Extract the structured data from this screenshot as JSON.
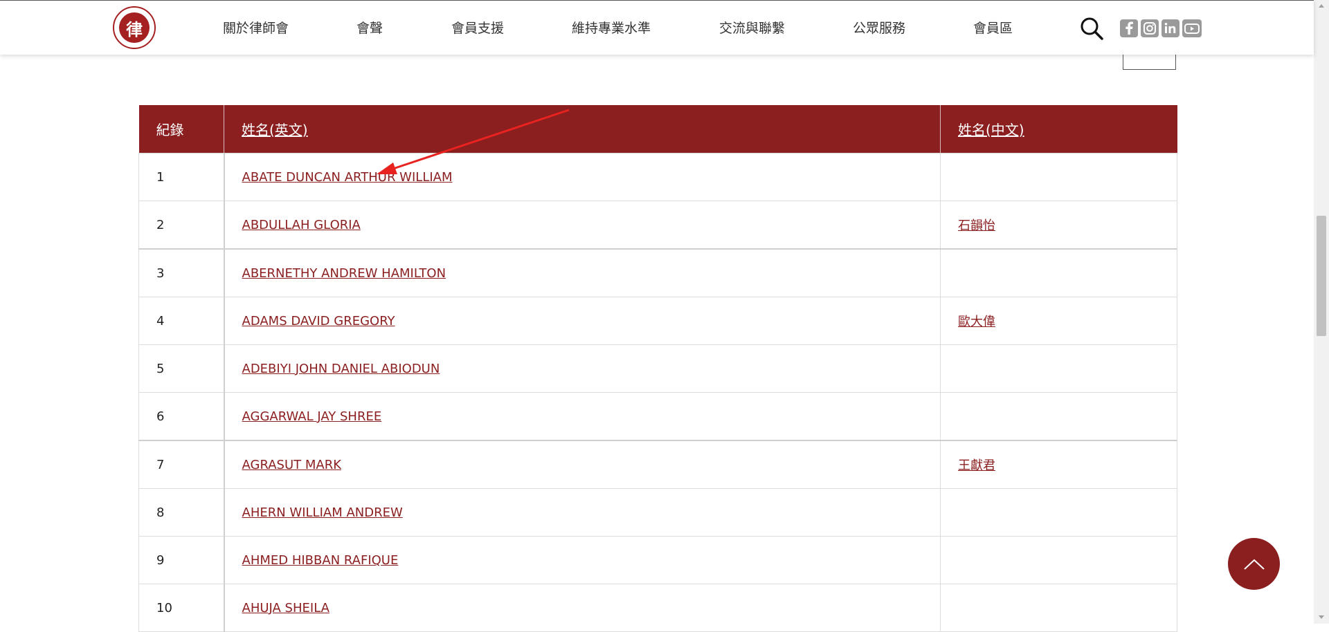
{
  "logo": {
    "mark": "律"
  },
  "nav": [
    "關於律師會",
    "會聲",
    "會員支援",
    "維持專業水準",
    "交流與聯繫",
    "公眾服務",
    "會員區"
  ],
  "social_icons": [
    "facebook-icon",
    "instagram-icon",
    "linkedin-icon",
    "youtube-icon"
  ],
  "colors": {
    "brand": "#8b1e1f",
    "annotation_arrow": "#e8231f"
  },
  "table": {
    "headers": {
      "no": "紀錄",
      "name_en": "姓名(英文)",
      "name_zh": "姓名(中文)"
    },
    "rows": [
      {
        "no": "1",
        "name_en": "ABATE DUNCAN ARTHUR WILLIAM",
        "name_zh": ""
      },
      {
        "no": "2",
        "name_en": "ABDULLAH GLORIA",
        "name_zh": "石韻怡"
      },
      {
        "no": "3",
        "name_en": "ABERNETHY ANDREW HAMILTON",
        "name_zh": ""
      },
      {
        "no": "4",
        "name_en": "ADAMS DAVID GREGORY",
        "name_zh": "歐大偉"
      },
      {
        "no": "5",
        "name_en": "ADEBIYI JOHN DANIEL ABIODUN",
        "name_zh": ""
      },
      {
        "no": "6",
        "name_en": "AGGARWAL JAY SHREE",
        "name_zh": ""
      },
      {
        "no": "7",
        "name_en": "AGRASUT MARK",
        "name_zh": "王獻君"
      },
      {
        "no": "8",
        "name_en": "AHERN WILLIAM ANDREW",
        "name_zh": ""
      },
      {
        "no": "9",
        "name_en": "AHMED HIBBAN RAFIQUE",
        "name_zh": ""
      },
      {
        "no": "10",
        "name_en": "AHUJA SHEILA",
        "name_zh": ""
      }
    ]
  }
}
